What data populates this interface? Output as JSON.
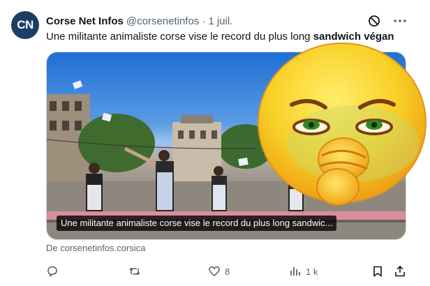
{
  "avatar": {
    "initials": "CN",
    "color": "#1d3d66"
  },
  "author": {
    "name": "Corse Net Infos",
    "handle": "@corsenetinfos",
    "separator": "·",
    "timestamp": "1 juil."
  },
  "tweet": {
    "text_regular": "Une militante animaliste corse vise le record du plus long ",
    "text_bold": "sandwich végan"
  },
  "media": {
    "caption": "Une militante animaliste corse vise le record du plus long sandwic..."
  },
  "overlay": {
    "emoji": "nauseated-face-emoji"
  },
  "source": {
    "text": "De corsenetinfos.corsica"
  },
  "actions": {
    "reply_count": "",
    "retweet_count": "",
    "like_count": "8",
    "views_count": "1 k"
  },
  "colors": {
    "muted_text": "#536471",
    "primary_text": "#0f1419",
    "emoji_yellow": "#f8d02c"
  },
  "icons": [
    "mute-icon",
    "more-icon",
    "reply-icon",
    "retweet-icon",
    "like-icon",
    "views-icon",
    "bookmark-icon",
    "share-icon"
  ]
}
